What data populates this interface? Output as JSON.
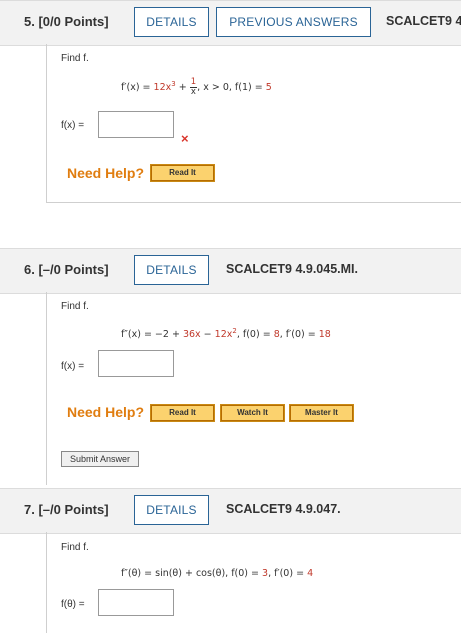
{
  "q5": {
    "number": "5. [0/0 Points]",
    "details_label": "DETAILS",
    "prev_label": "PREVIOUS ANSWERS",
    "code": "SCALCET9 4.",
    "find": "Find f.",
    "eq_lhs": "f′(x) = ",
    "eq_a": "12x",
    "eq_a_exp": "3",
    "eq_plus": " + ",
    "eq_frac_num": "1",
    "eq_frac_den": "x",
    "eq_rest": ",    x > 0,    f(1) = ",
    "eq_init": "5",
    "answer_label": "f(x) =",
    "answer_value": "",
    "result_icon": "×",
    "need_help": "Need Help?",
    "read_label": "Read It"
  },
  "q6": {
    "number": "6. [–/0 Points]",
    "details_label": "DETAILS",
    "code": "SCALCET9 4.9.045.MI.",
    "find": "Find f.",
    "eq_lhs": "f″(x) = −2 + ",
    "eq_a": "36x",
    "eq_mid": " − ",
    "eq_b": "12x",
    "eq_b_exp": "2",
    "eq_rest1": ",    f(0) = ",
    "eq_init1": "8",
    "eq_rest2": ",    f′(0) = ",
    "eq_init2": "18",
    "answer_label": "f(x) =",
    "answer_value": "",
    "need_help": "Need Help?",
    "read_label": "Read It",
    "watch_label": "Watch It",
    "master_label": "Master It",
    "submit_label": "Submit Answer"
  },
  "q7": {
    "number": "7. [–/0 Points]",
    "details_label": "DETAILS",
    "code": "SCALCET9 4.9.047.",
    "find": "Find f.",
    "eq_lhs": "f″(θ) = sin(θ) + cos(θ),    f(0) = ",
    "eq_init1": "3",
    "eq_rest2": ",    f′(0) = ",
    "eq_init2": "4",
    "answer_label": "f(θ) =",
    "answer_value": ""
  },
  "colors": {
    "accent": "#2a6496",
    "help": "#e07d10",
    "help_button": "#fbd26e",
    "incorrect": "#d9342b",
    "highlight": "#c0392b"
  }
}
